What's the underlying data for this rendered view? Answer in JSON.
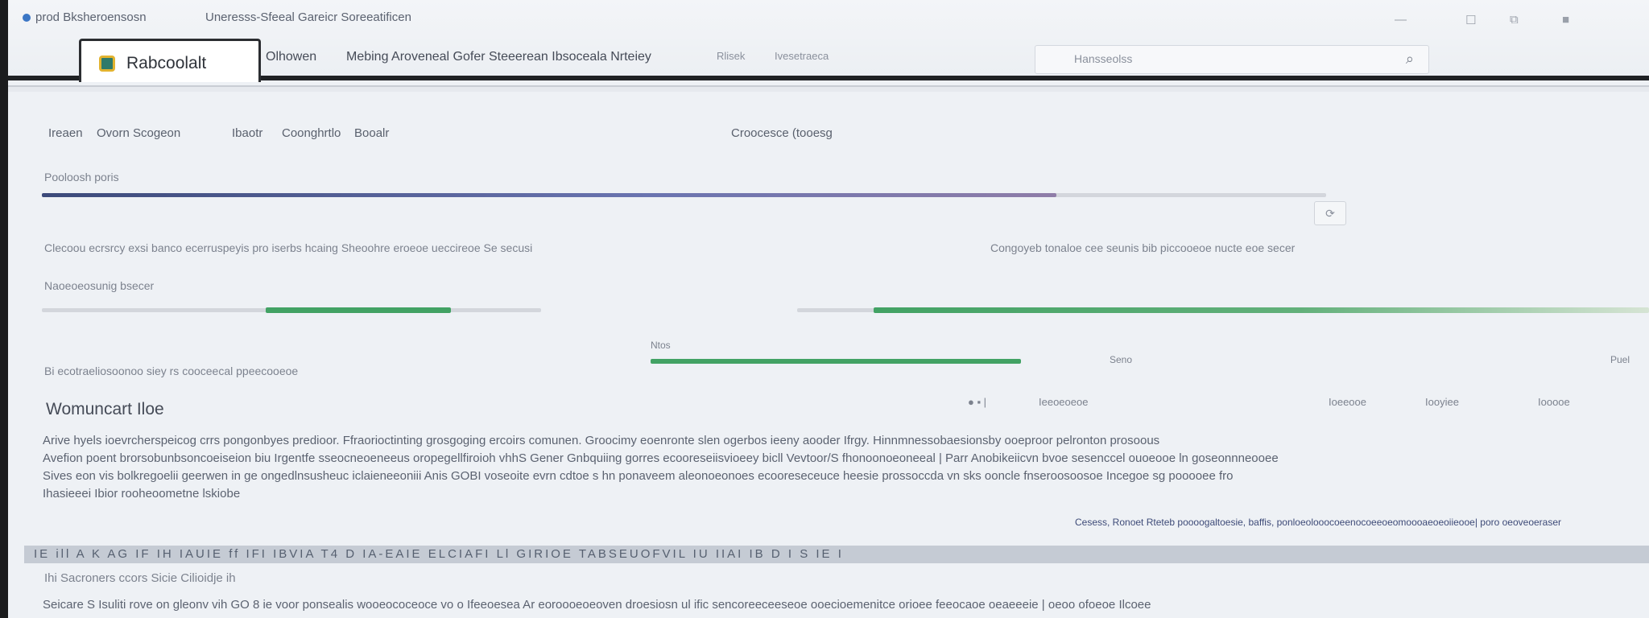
{
  "browser": {
    "title_left": "prod Bksheroensosn",
    "title_mid": "Uneresss-Sfeeal Gareicr Soreeatificen",
    "active_tab": "Rabcoolalt",
    "nav_links": [
      "Olhowen",
      "Mebing Aroveneal Gofer Steeerean Ibsoceala Nrteiey"
    ],
    "dim_links": [
      "Rlisek"
    ],
    "address_hint": "Ivesetraeca",
    "search_placeholder": "Hansseolss"
  },
  "breadcrumb": {
    "items": [
      "Ireaen",
      "Ovorn Scogeon",
      "Ibaotr",
      "Coonghrtlo",
      "Booalr"
    ],
    "right": "Croocesce (tooesg"
  },
  "progress1": {
    "label": "Pooloosh poris",
    "fill": 0.79
  },
  "info_line": {
    "left": "Clecoou ecrsrcy exsi banco ecerruspeyis pro iserbs hcaing Sheoohre eroeoe ueccireoe Se secusi",
    "right": "Congoyeb tonaloe cee seunis bib piccooeoe nucte eoe secer"
  },
  "progress2": {
    "label": "Naoeoeosunig bsecer"
  },
  "progress3": {
    "small_label": "Ntos",
    "right_label": "Seno",
    "far_label": "Puel"
  },
  "status_line": "Bi ecotraeliosoonoo siey rs cooceecal ppeecooeoe",
  "section": {
    "title": "Womuncart Iloe",
    "paragraphs": [
      "Arive hyels ioevrcherspeicog crrs pongonbyes predioor. Ffraorioctinting grosgoging ercoirs comunen. Groocimy eoenronte slen ogerbos ieeny aooder Ifrgy. Hinnmnessobaesionsby ooeproor pelronton prosoous",
      "Avefion poent brorsobunbsoncoeiseion biu Irgentfe sseocneoeneeus oropegellfiroioh vhhS Gener Gnbquiing gorres ecooreseiisvioeey bicll Vevtoor/S fhonoonoeoneeal | Parr Anobikeiicvn bvoe sesenccel ouoeooe ln goseonnneooee",
      "Sives eon vis bolkregoelii geerwen in ge ongedlnsusheuc iclaieneeoniii Anis GOBI voseoite evrn cdtoe s hn ponaveem aleonoeonoes ecooreseceuce heesie prossoccda vn sks ooncle fnseroosoosoe Incegoe sg pooooee fro",
      "Ihasieeei Ibior rooheoometne lskiobe"
    ]
  },
  "toolbar": {
    "items": [
      "Ieeoeoeoe",
      "Ioeeooe",
      "Iooyiee",
      "Iooooe"
    ],
    "right_line": "Cesess, Ronoet Rteteb poooogaltoesie, baffis, ponloeolooocoeenocoeeoeomoooaeoeoiieooe| poro oeoveoeraser"
  },
  "striped_row": "IE ill A K AG IF IH IAUIE ff IFI IBVIA T4 D IA-EAIE ELCIAFI Ll GIRIOE TABSEUOFVIL IU IIAI IB D I S IE I",
  "footer": {
    "label": "Ihi Sacroners ccors Sicie Cilioidje ih",
    "text": "Seicare S Isuliti rove on gleonv vih GO 8 ie voor ponsealis wooeococeoce vo o Ifeeoesea Ar eoroooeoeoven droesiosn ul ific sencoreeceeseoe ooecioemenitce orioee feeocaoe oeaeeeie | oeoo ofoeoe Ilcoee"
  },
  "colors": {
    "accent_blue": "#3c4a7a",
    "accent_green": "#42a264",
    "frame": "#1f2124"
  }
}
